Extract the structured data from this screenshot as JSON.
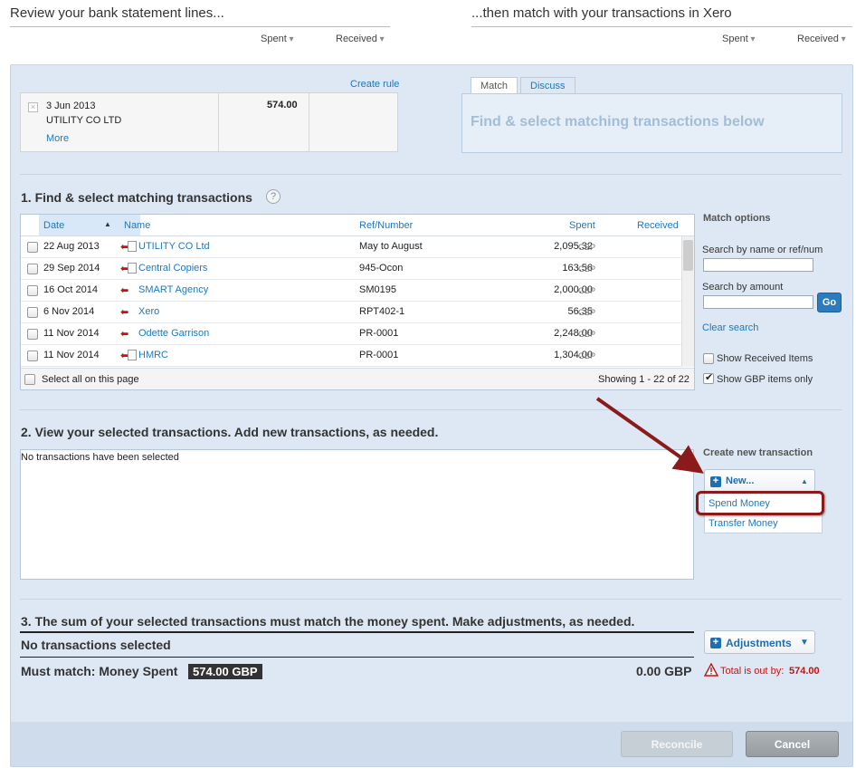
{
  "top": {
    "left_title": "Review your bank statement lines...",
    "right_title": "...then match with your transactions in Xero",
    "spent_label": "Spent",
    "received_label": "Received"
  },
  "statement": {
    "date": "3 Jun 2013",
    "payee": "UTILITY CO LTD",
    "more_link": "More",
    "amount": "574.00",
    "create_rule": "Create rule"
  },
  "match_panel": {
    "tabs": [
      "Match",
      "Discuss"
    ],
    "prompt": "Find & select matching transactions below"
  },
  "section1": {
    "title": "1. Find & select matching transactions",
    "help_icon": "question-circle-icon",
    "columns": {
      "date": "Date",
      "name": "Name",
      "ref": "Ref/Number",
      "spent": "Spent",
      "received": "Received"
    },
    "rows": [
      {
        "date": "22 Aug 2013",
        "name": "UTILITY CO Ltd",
        "ref": "May to August",
        "spent": "2,095.32",
        "currency": "GBP"
      },
      {
        "date": "29 Sep 2014",
        "name": "Central Copiers",
        "ref": "945-Ocon",
        "spent": "163.56",
        "currency": "GBP"
      },
      {
        "date": "16 Oct 2014",
        "name": "SMART Agency",
        "ref": "SM0195",
        "spent": "2,000.00",
        "currency": "GBP"
      },
      {
        "date": "6 Nov 2014",
        "name": "Xero",
        "ref": "RPT402-1",
        "spent": "56.35",
        "currency": "GBP"
      },
      {
        "date": "11 Nov 2014",
        "name": "Odette Garrison",
        "ref": "PR-0001",
        "spent": "2,248.00",
        "currency": "GBP"
      },
      {
        "date": "11 Nov 2014",
        "name": "HMRC",
        "ref": "PR-0001",
        "spent": "1,304.00",
        "currency": "GBP"
      }
    ],
    "select_all": "Select all on this page",
    "showing": "Showing 1 - 22 of 22"
  },
  "match_options": {
    "title": "Match options",
    "search_name_label": "Search by name or ref/num",
    "search_name_value": "",
    "search_amount_label": "Search by amount",
    "search_amount_value": "",
    "go_label": "Go",
    "clear_search": "Clear search",
    "show_received": "Show Received Items",
    "show_received_checked": false,
    "show_gbp": "Show GBP items only",
    "show_gbp_checked": true
  },
  "section2": {
    "title": "2. View your selected transactions. Add new transactions, as needed.",
    "empty_text": "No transactions have been selected",
    "create_title": "Create new transaction",
    "new_label": "New...",
    "menu": [
      "Spend Money",
      "Transfer Money"
    ],
    "highlight_color": "#8b1a1a"
  },
  "section3": {
    "title": "3. The sum of your selected transactions must match the money spent. Make adjustments, as needed.",
    "no_selected": "No transactions selected",
    "must_match_label": "Must match: Money Spent",
    "must_match_value": "574.00 GBP",
    "total_value": "0.00 GBP",
    "adjustments_label": "Adjustments",
    "out_by_label": "Total is out by:",
    "out_by_value": "574.00"
  },
  "footer": {
    "reconcile_label": "Reconcile",
    "cancel_label": "Cancel"
  }
}
